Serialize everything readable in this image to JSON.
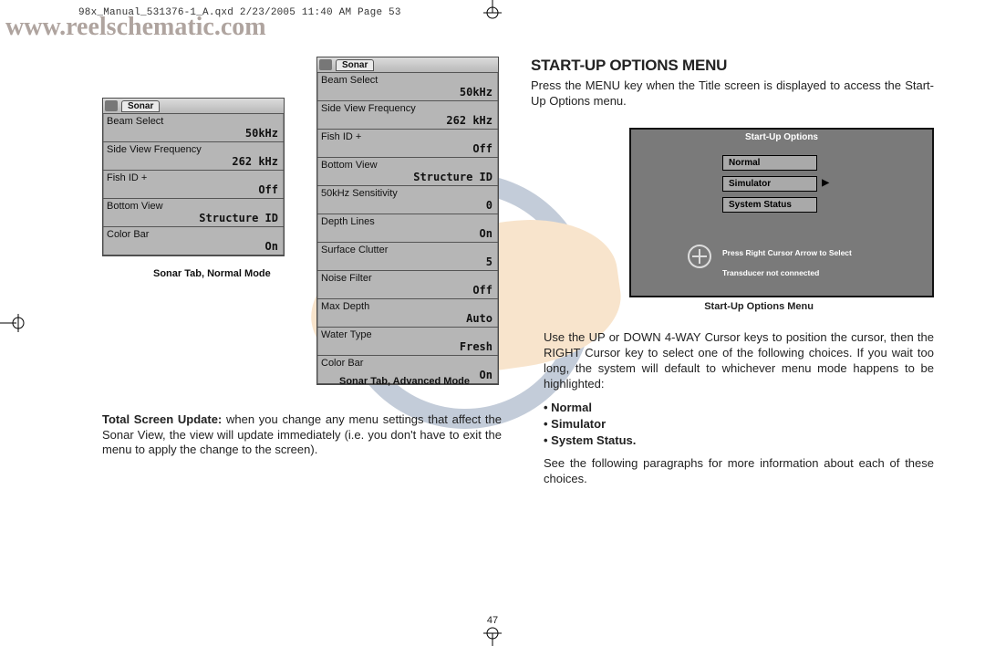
{
  "header_line": "98x_Manual_531376-1_A.qxd  2/23/2005  11:40 AM  Page 53",
  "watermark_url": "www.reelschematic.com",
  "page_number": "47",
  "left": {
    "sonar_tab_label": "Sonar",
    "normal_caption": "Sonar Tab, Normal Mode",
    "advanced_caption": "Sonar Tab, Advanced Mode",
    "normal_rows": [
      {
        "label": "Beam Select",
        "value": "50kHz"
      },
      {
        "label": "Side View Frequency",
        "value": "262 kHz"
      },
      {
        "label": "Fish ID +",
        "value": "Off"
      },
      {
        "label": "Bottom View",
        "value": "Structure ID"
      },
      {
        "label": "Color Bar",
        "value": "On"
      }
    ],
    "advanced_rows": [
      {
        "label": "Beam Select",
        "value": "50kHz"
      },
      {
        "label": "Side View Frequency",
        "value": "262 kHz"
      },
      {
        "label": "Fish ID +",
        "value": "Off"
      },
      {
        "label": "Bottom View",
        "value": "Structure ID"
      },
      {
        "label": "50kHz Sensitivity",
        "value": "0"
      },
      {
        "label": "Depth Lines",
        "value": "On"
      },
      {
        "label": "Surface Clutter",
        "value": "5"
      },
      {
        "label": "Noise Filter",
        "value": "Off"
      },
      {
        "label": "Max Depth",
        "value": "Auto"
      },
      {
        "label": "Water Type",
        "value": "Fresh"
      },
      {
        "label": "Color Bar",
        "value": "On"
      }
    ],
    "body_lead": "Total Screen Update: ",
    "body_rest": "when you change any menu settings that affect the Sonar View, the view will update immediately (i.e. you don't have to exit the menu to apply the change to the screen)."
  },
  "right": {
    "heading": "START-UP OPTIONS MENU",
    "intro": "Press the MENU key when the Title screen is displayed to access the Start-Up Options menu.",
    "shot": {
      "title": "Start-Up Options",
      "options": [
        "Normal",
        "Simulator",
        "System Status"
      ],
      "selected_index": 1,
      "hint1": "Press Right Cursor Arrow to Select",
      "hint2": "Transducer not connected"
    },
    "shot_caption": "Start-Up Options Menu",
    "body1": "Use the UP or DOWN 4-WAY Cursor keys to position the cursor, then the RIGHT Cursor key to select one of the following choices. If you wait too long, the system will default to whichever menu mode happens to be highlighted:",
    "bullets": [
      "Normal",
      "Simulator",
      "System Status."
    ],
    "body2": "See the following paragraphs for more information about each of these choices."
  }
}
